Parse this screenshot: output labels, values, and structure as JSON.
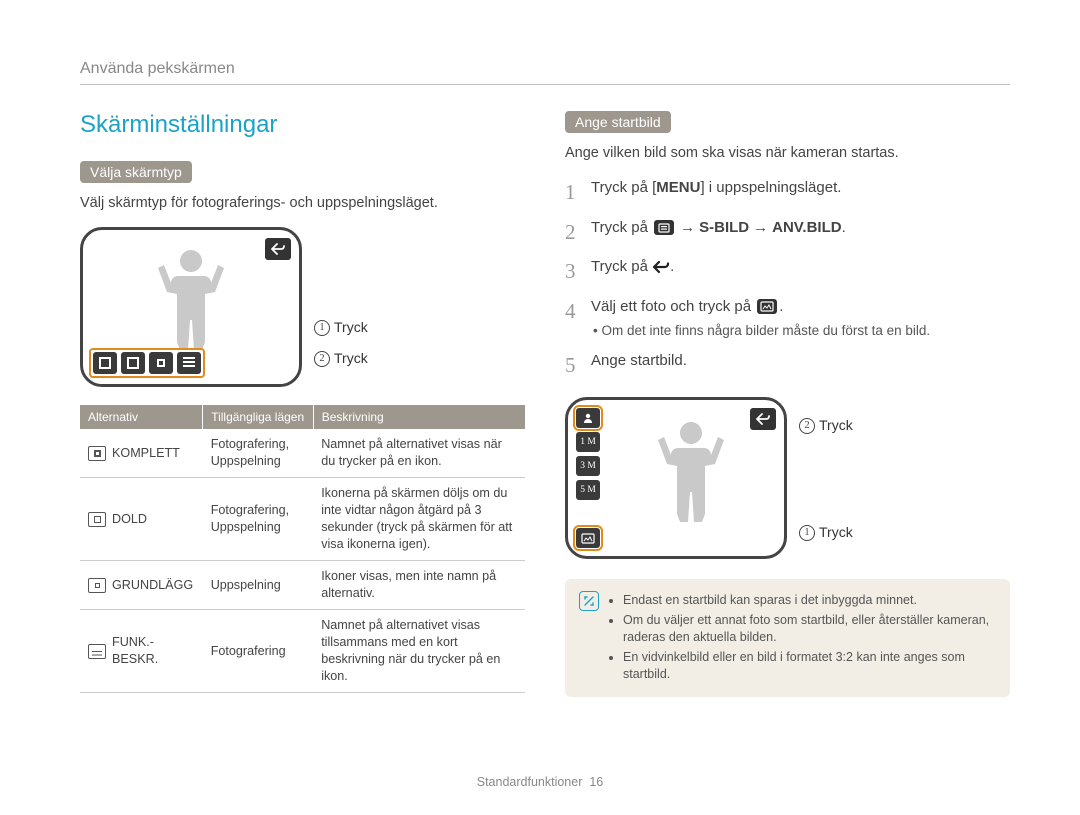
{
  "breadcrumb": "Använda pekskärmen",
  "page_title": "Skärminställningar",
  "left": {
    "section_label": "Välja skärmtyp",
    "section_intro": "Välj skärmtyp för fotograferings- och uppspelningsläget.",
    "callouts": [
      {
        "num": "1",
        "text": "Tryck"
      },
      {
        "num": "2",
        "text": "Tryck"
      }
    ],
    "table": {
      "headers": [
        "Alternativ",
        "Tillgängliga lägen",
        "Beskrivning"
      ],
      "rows": [
        {
          "name": "KOMPLETT",
          "modes": "Fotografering, Uppspelning",
          "desc": "Namnet på alternativet visas när du trycker på en ikon."
        },
        {
          "name": "DOLD",
          "modes": "Fotografering, Uppspelning",
          "desc": "Ikonerna på skärmen döljs om du inte vidtar någon åtgärd på 3 sekunder (tryck på skärmen för att visa ikonerna igen)."
        },
        {
          "name": "GRUNDLÄGG",
          "modes": "Uppspelning",
          "desc": "Ikoner visas, men inte namn på alternativ."
        },
        {
          "name": "FUNK.-BESKR.",
          "modes": "Fotografering",
          "desc": "Namnet på alternativet visas tillsammans med en kort beskrivning när du trycker på en ikon."
        }
      ]
    }
  },
  "right": {
    "section_label": "Ange startbild",
    "section_intro": "Ange vilken bild som ska visas när kameran startas.",
    "steps": [
      {
        "num": "1",
        "pre": "Tryck på [",
        "strong": "MENU",
        "post": "] i uppspelningsläget."
      },
      {
        "num": "2",
        "pre": "Tryck på ",
        "icon_after_pre": true,
        "arrow1": "→",
        "strong": "S-BILD",
        "arrow2": "→",
        "strong2": "ANV.BILD",
        "post2": "."
      },
      {
        "num": "3",
        "pre": "Tryck på ",
        "back_icon": true,
        "post": "."
      },
      {
        "num": "4",
        "pre": "Välj ett foto och tryck på ",
        "icon_end": true,
        "post": ".",
        "sub": "Om det inte finns några bilder måste du först ta en bild."
      },
      {
        "num": "5",
        "pre": "Ange startbild."
      }
    ],
    "callouts": [
      {
        "num": "2",
        "text": "Tryck"
      },
      {
        "num": "1",
        "text": "Tryck"
      }
    ],
    "screen_labels": [
      "1 M",
      "3 M",
      "5 M"
    ],
    "notes": [
      "Endast en startbild kan sparas i det inbyggda minnet.",
      "Om du väljer ett annat foto som startbild, eller återställer kameran, raderas den aktuella bilden.",
      "En vidvinkelbild eller en bild i formatet 3:2 kan inte anges som startbild."
    ]
  },
  "footer": {
    "section": "Standardfunktioner",
    "page": "16"
  }
}
